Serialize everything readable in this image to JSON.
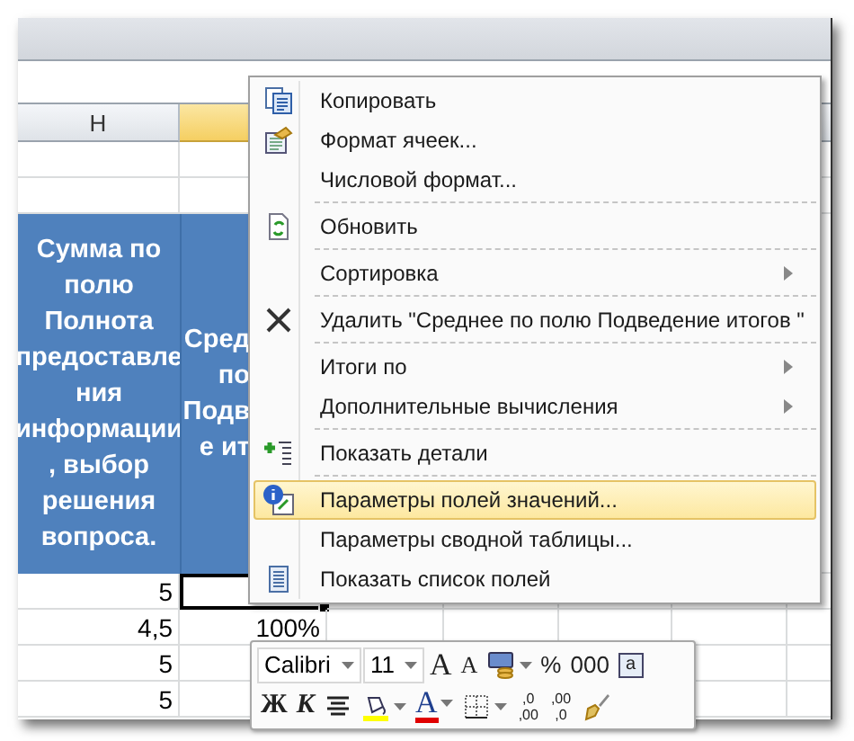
{
  "sheet": {
    "columns": [
      {
        "label": "H",
        "selected": false
      },
      {
        "selected": true
      }
    ],
    "header_cells": [
      {
        "lines": [
          "Сумма по",
          "полю",
          "Полнота",
          "предоставле",
          "ния",
          "информации",
          ", выбор",
          "решения",
          "вопроса."
        ]
      },
      {
        "lines": [
          "Сред",
          "по",
          "Подв",
          "е ит"
        ]
      }
    ],
    "rows": [
      {
        "cells": [
          "5",
          ""
        ],
        "active": true
      },
      {
        "cells": [
          "4,5",
          "100%"
        ],
        "active": false
      },
      {
        "cells": [
          "5",
          ""
        ],
        "active": false
      },
      {
        "cells": [
          "5",
          ""
        ],
        "active": false
      }
    ]
  },
  "context_menu": {
    "items": [
      {
        "label": "Копировать",
        "kind": "copy",
        "submenu": false,
        "selected": false
      },
      {
        "label": "Формат ячеек...",
        "kind": "format",
        "submenu": false,
        "selected": false
      },
      {
        "label": "Числовой формат...",
        "kind": "plain",
        "submenu": false,
        "selected": false
      },
      {
        "kind": "separator"
      },
      {
        "label": "Обновить",
        "kind": "refresh",
        "submenu": false,
        "selected": false
      },
      {
        "kind": "separator"
      },
      {
        "label": "Сортировка",
        "kind": "plain",
        "submenu": true,
        "selected": false
      },
      {
        "kind": "separator"
      },
      {
        "label": "Удалить \"Среднее по полю Подведение итогов \"",
        "kind": "delete",
        "submenu": false,
        "selected": false
      },
      {
        "kind": "separator"
      },
      {
        "label": "Итоги по",
        "kind": "plain",
        "submenu": true,
        "selected": false
      },
      {
        "label": "Дополнительные вычисления",
        "kind": "plain",
        "submenu": true,
        "selected": false
      },
      {
        "kind": "separator"
      },
      {
        "label": "Показать детали",
        "kind": "details",
        "submenu": false,
        "selected": false
      },
      {
        "kind": "separator"
      },
      {
        "label": "Параметры полей значений...",
        "kind": "settings",
        "submenu": false,
        "selected": true
      },
      {
        "label": "Параметры сводной таблицы...",
        "kind": "plain",
        "submenu": false,
        "selected": false
      },
      {
        "label": "Показать список полей",
        "kind": "list",
        "submenu": false,
        "selected": false
      }
    ]
  },
  "mini_toolbar": {
    "font_row": [
      {
        "kind": "combo",
        "text": "Calibri"
      },
      {
        "kind": "combo",
        "text": "11"
      },
      {
        "kind": "grow",
        "text": "A"
      },
      {
        "kind": "shrink",
        "text": "A"
      },
      {
        "kind": "accounting"
      },
      {
        "kind": "glyph",
        "text": "%"
      },
      {
        "kind": "glyph",
        "text": "000"
      },
      {
        "kind": "merge",
        "text": "a"
      }
    ],
    "format_row": [
      {
        "kind": "bold",
        "text": "Ж"
      },
      {
        "kind": "italic",
        "text": "К"
      },
      {
        "kind": "center"
      },
      {
        "kind": "fill"
      },
      {
        "kind": "fontcolor",
        "text": "A"
      },
      {
        "kind": "borders"
      },
      {
        "kind": "decimal",
        "top": ",0",
        "bottom": ",00"
      },
      {
        "kind": "decimal",
        "top": ",00",
        "bottom": ",0"
      },
      {
        "kind": "painter"
      }
    ]
  }
}
